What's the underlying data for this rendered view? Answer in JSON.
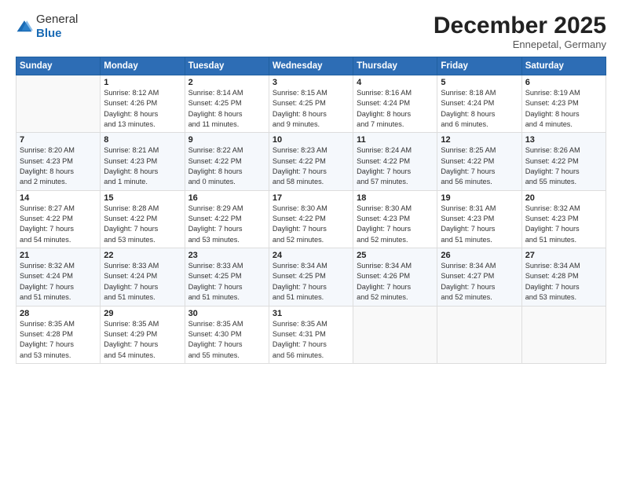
{
  "header": {
    "logo": {
      "general": "General",
      "blue": "Blue"
    },
    "title": "December 2025",
    "location": "Ennepetal, Germany"
  },
  "weekdays": [
    "Sunday",
    "Monday",
    "Tuesday",
    "Wednesday",
    "Thursday",
    "Friday",
    "Saturday"
  ],
  "weeks": [
    [
      {
        "day": "",
        "info": ""
      },
      {
        "day": "1",
        "info": "Sunrise: 8:12 AM\nSunset: 4:26 PM\nDaylight: 8 hours\nand 13 minutes."
      },
      {
        "day": "2",
        "info": "Sunrise: 8:14 AM\nSunset: 4:25 PM\nDaylight: 8 hours\nand 11 minutes."
      },
      {
        "day": "3",
        "info": "Sunrise: 8:15 AM\nSunset: 4:25 PM\nDaylight: 8 hours\nand 9 minutes."
      },
      {
        "day": "4",
        "info": "Sunrise: 8:16 AM\nSunset: 4:24 PM\nDaylight: 8 hours\nand 7 minutes."
      },
      {
        "day": "5",
        "info": "Sunrise: 8:18 AM\nSunset: 4:24 PM\nDaylight: 8 hours\nand 6 minutes."
      },
      {
        "day": "6",
        "info": "Sunrise: 8:19 AM\nSunset: 4:23 PM\nDaylight: 8 hours\nand 4 minutes."
      }
    ],
    [
      {
        "day": "7",
        "info": "Sunrise: 8:20 AM\nSunset: 4:23 PM\nDaylight: 8 hours\nand 2 minutes."
      },
      {
        "day": "8",
        "info": "Sunrise: 8:21 AM\nSunset: 4:23 PM\nDaylight: 8 hours\nand 1 minute."
      },
      {
        "day": "9",
        "info": "Sunrise: 8:22 AM\nSunset: 4:22 PM\nDaylight: 8 hours\nand 0 minutes."
      },
      {
        "day": "10",
        "info": "Sunrise: 8:23 AM\nSunset: 4:22 PM\nDaylight: 7 hours\nand 58 minutes."
      },
      {
        "day": "11",
        "info": "Sunrise: 8:24 AM\nSunset: 4:22 PM\nDaylight: 7 hours\nand 57 minutes."
      },
      {
        "day": "12",
        "info": "Sunrise: 8:25 AM\nSunset: 4:22 PM\nDaylight: 7 hours\nand 56 minutes."
      },
      {
        "day": "13",
        "info": "Sunrise: 8:26 AM\nSunset: 4:22 PM\nDaylight: 7 hours\nand 55 minutes."
      }
    ],
    [
      {
        "day": "14",
        "info": "Sunrise: 8:27 AM\nSunset: 4:22 PM\nDaylight: 7 hours\nand 54 minutes."
      },
      {
        "day": "15",
        "info": "Sunrise: 8:28 AM\nSunset: 4:22 PM\nDaylight: 7 hours\nand 53 minutes."
      },
      {
        "day": "16",
        "info": "Sunrise: 8:29 AM\nSunset: 4:22 PM\nDaylight: 7 hours\nand 53 minutes."
      },
      {
        "day": "17",
        "info": "Sunrise: 8:30 AM\nSunset: 4:22 PM\nDaylight: 7 hours\nand 52 minutes."
      },
      {
        "day": "18",
        "info": "Sunrise: 8:30 AM\nSunset: 4:23 PM\nDaylight: 7 hours\nand 52 minutes."
      },
      {
        "day": "19",
        "info": "Sunrise: 8:31 AM\nSunset: 4:23 PM\nDaylight: 7 hours\nand 51 minutes."
      },
      {
        "day": "20",
        "info": "Sunrise: 8:32 AM\nSunset: 4:23 PM\nDaylight: 7 hours\nand 51 minutes."
      }
    ],
    [
      {
        "day": "21",
        "info": "Sunrise: 8:32 AM\nSunset: 4:24 PM\nDaylight: 7 hours\nand 51 minutes."
      },
      {
        "day": "22",
        "info": "Sunrise: 8:33 AM\nSunset: 4:24 PM\nDaylight: 7 hours\nand 51 minutes."
      },
      {
        "day": "23",
        "info": "Sunrise: 8:33 AM\nSunset: 4:25 PM\nDaylight: 7 hours\nand 51 minutes."
      },
      {
        "day": "24",
        "info": "Sunrise: 8:34 AM\nSunset: 4:25 PM\nDaylight: 7 hours\nand 51 minutes."
      },
      {
        "day": "25",
        "info": "Sunrise: 8:34 AM\nSunset: 4:26 PM\nDaylight: 7 hours\nand 52 minutes."
      },
      {
        "day": "26",
        "info": "Sunrise: 8:34 AM\nSunset: 4:27 PM\nDaylight: 7 hours\nand 52 minutes."
      },
      {
        "day": "27",
        "info": "Sunrise: 8:34 AM\nSunset: 4:28 PM\nDaylight: 7 hours\nand 53 minutes."
      }
    ],
    [
      {
        "day": "28",
        "info": "Sunrise: 8:35 AM\nSunset: 4:28 PM\nDaylight: 7 hours\nand 53 minutes."
      },
      {
        "day": "29",
        "info": "Sunrise: 8:35 AM\nSunset: 4:29 PM\nDaylight: 7 hours\nand 54 minutes."
      },
      {
        "day": "30",
        "info": "Sunrise: 8:35 AM\nSunset: 4:30 PM\nDaylight: 7 hours\nand 55 minutes."
      },
      {
        "day": "31",
        "info": "Sunrise: 8:35 AM\nSunset: 4:31 PM\nDaylight: 7 hours\nand 56 minutes."
      },
      {
        "day": "",
        "info": ""
      },
      {
        "day": "",
        "info": ""
      },
      {
        "day": "",
        "info": ""
      }
    ]
  ]
}
